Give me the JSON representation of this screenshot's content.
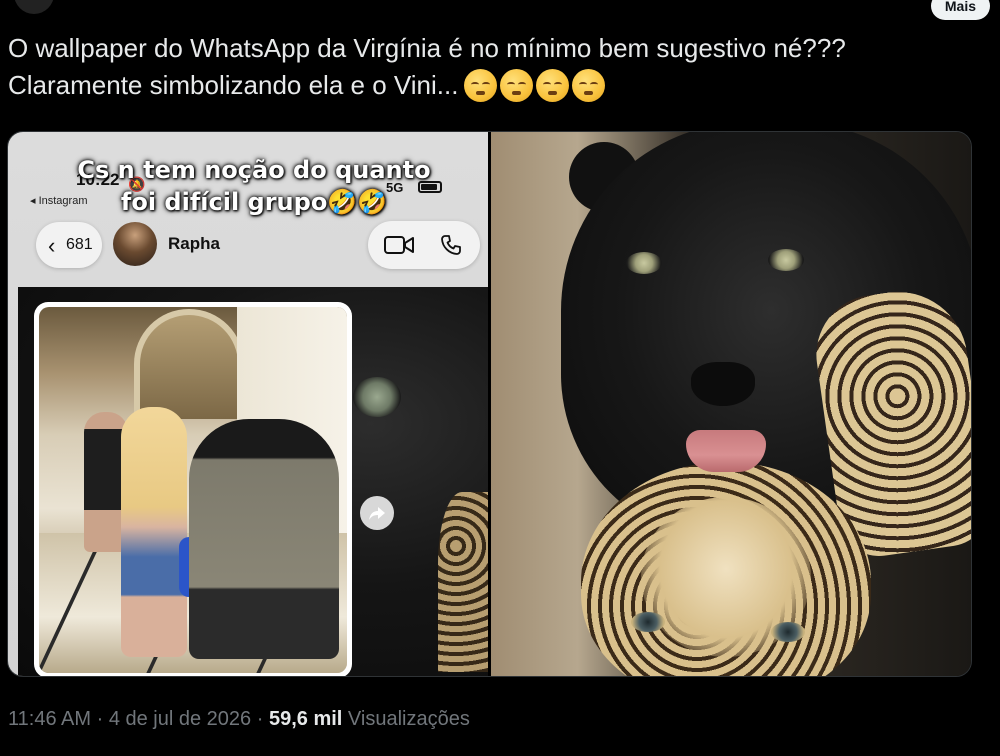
{
  "header": {
    "more_label": "Mais"
  },
  "tweet": {
    "line1": "O wallpaper do WhatsApp da Virgínia é no mínimo bem sugestivo né???",
    "line2": "Claramente simbolizando ela e o Vini...",
    "emoji_names": [
      "face-exhaling-icon",
      "face-exhaling-icon",
      "face-exhaling-icon",
      "face-exhaling-icon"
    ]
  },
  "left_image": {
    "caption_line1": "Cs n tem noção do quanto",
    "caption_line2": "foi difícil grupo🤣🤣",
    "status_time": "10:22",
    "status_back": "◂ Instagram",
    "network": "5G",
    "back_count": "681",
    "contact_name": "Rapha"
  },
  "meta": {
    "time": "11:46 AM",
    "separator": "·",
    "date": "4 de jul de 2026",
    "views_count": "59,6 mil",
    "views_label": "Visualizações"
  },
  "colors": {
    "background": "#000000",
    "text_primary": "#e7e9ea",
    "text_secondary": "#71767b"
  }
}
